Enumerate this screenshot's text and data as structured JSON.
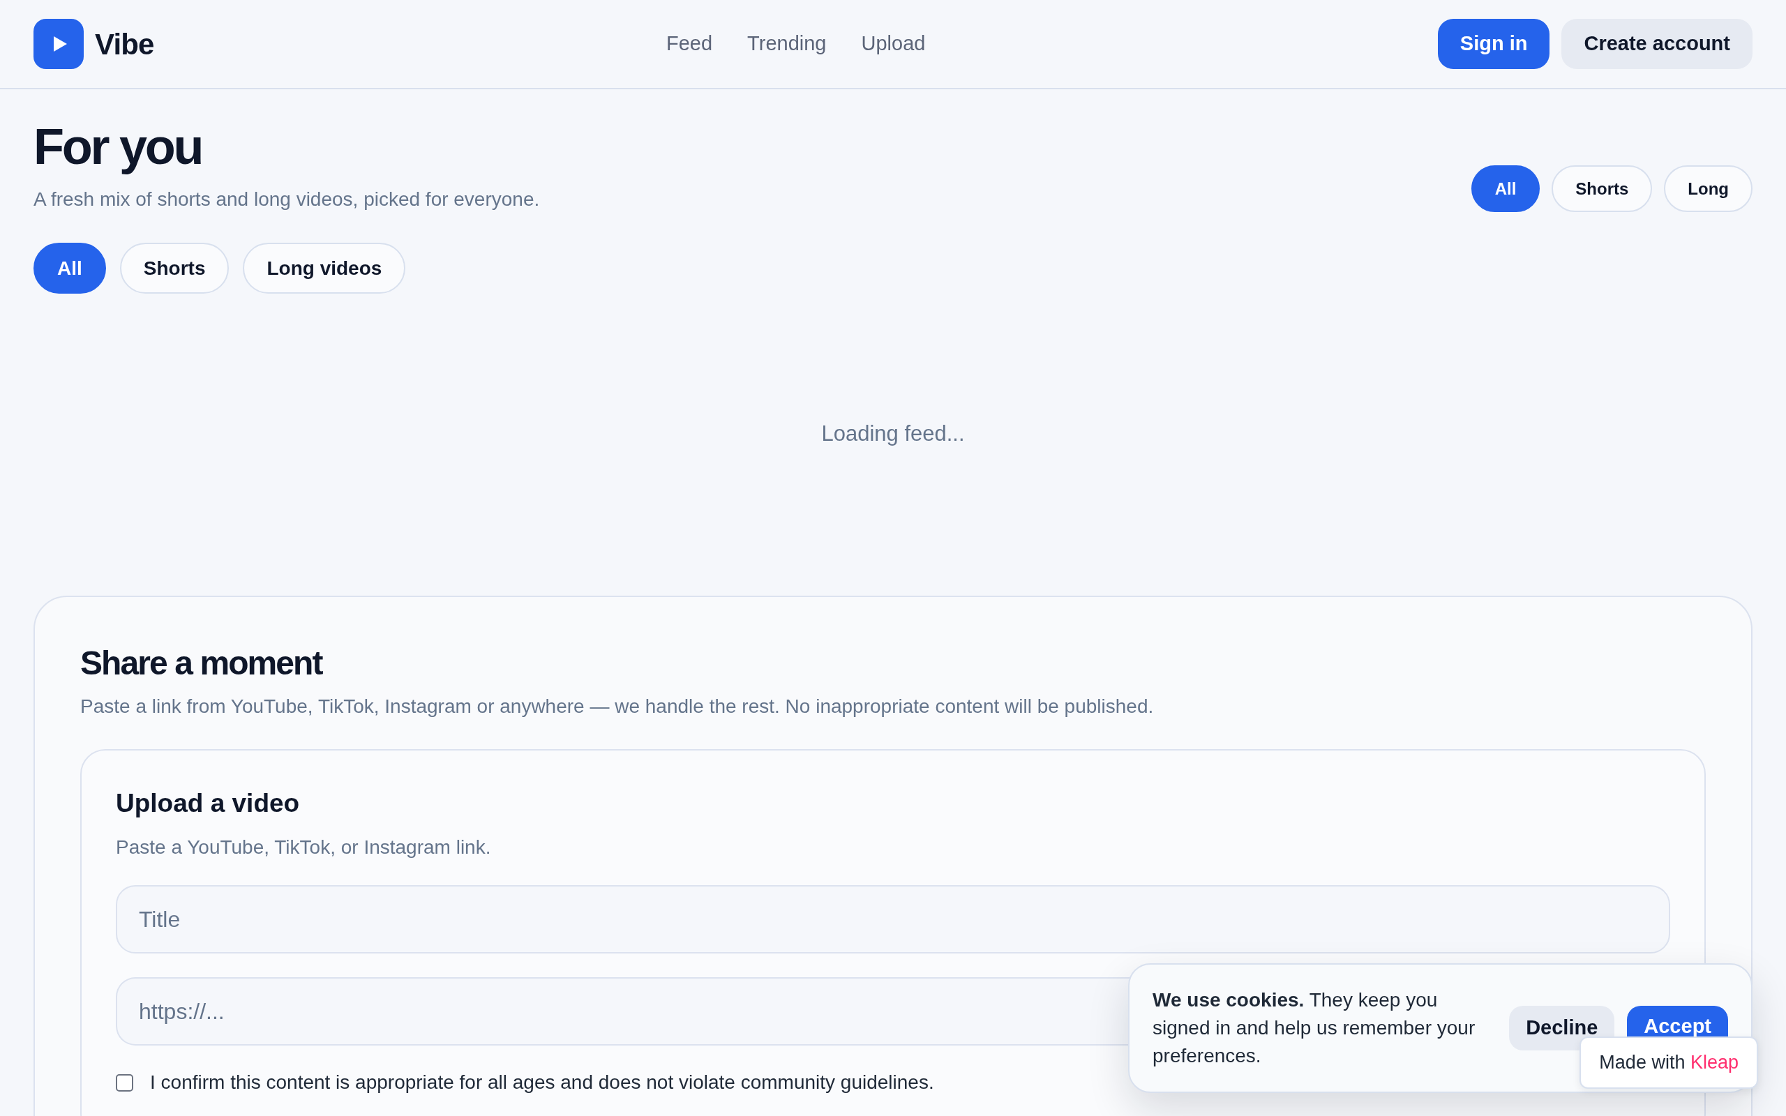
{
  "header": {
    "brand": "Vibe",
    "nav": [
      {
        "label": "Feed"
      },
      {
        "label": "Trending"
      },
      {
        "label": "Upload"
      }
    ],
    "actions": [
      {
        "label": "Sign in",
        "kind": "primary"
      },
      {
        "label": "Create account",
        "kind": "secondary"
      }
    ]
  },
  "feed": {
    "title": "For you",
    "subtitle": "A fresh mix of shorts and long videos, picked for everyone.",
    "compact_filters": [
      {
        "label": "All",
        "selected": true
      },
      {
        "label": "Shorts",
        "selected": false
      },
      {
        "label": "Long",
        "selected": false
      }
    ],
    "filters": [
      {
        "label": "All",
        "selected": true
      },
      {
        "label": "Shorts",
        "selected": false
      },
      {
        "label": "Long videos",
        "selected": false
      }
    ],
    "status": "Loading feed..."
  },
  "share": {
    "title": "Share a moment",
    "description": "Paste a link from YouTube, TikTok, Instagram or anywhere — we handle the rest. No inappropriate content will be published.",
    "upload": {
      "title": "Upload a video",
      "hint": "Paste a YouTube, TikTok, or Instagram link.",
      "fields": [
        {
          "placeholder": "Title"
        },
        {
          "placeholder": "https://..."
        }
      ],
      "confirm": {
        "label": "I confirm this content is appropriate for all ages and does not violate community guidelines.",
        "checked": false
      }
    }
  },
  "cookie_banner": {
    "text": "**We use cookies.** They keep you signed in and help us remember your preferences.",
    "buttons": [
      {
        "label": "Decline",
        "kind": "secondary"
      },
      {
        "label": "Accept",
        "kind": "primary"
      }
    ]
  },
  "made_with_badge": {
    "label": "Made with",
    "brand": "Kleap"
  }
}
